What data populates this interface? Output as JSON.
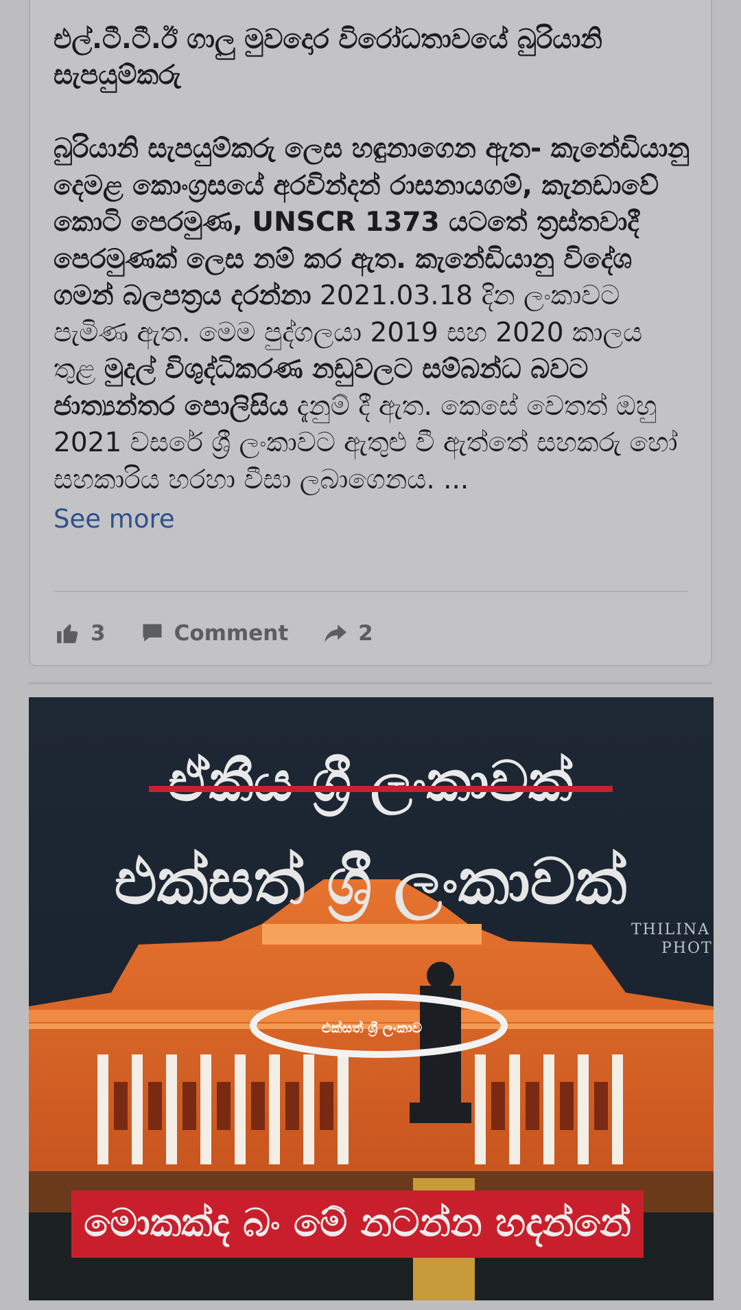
{
  "post": {
    "headline": "එල්.ටී.ටී.ඊ ගාලු මුවදොර විරෝධතාවයේ බුරියානි සැපයුම්කරු",
    "body_bold_1": "බුරියානි සැපයුම්කරු ලෙස හඳුනාගෙන ඇත- කැනේඩියානු දෙමළ කොංග්‍රසයේ අරවින්දන් රාසනායගම්, කැනඩාවේ කොටි පෙරමුණ, UNSCR 1373 යටතේ ත්‍රස්තවාදී පෙරමුණක් ලෙස නම් කර ඇත. කැනේඩියානු විදේශ ගමන් බලපත්‍රය දරන්නා",
    "body_normal_1": " 2021.03.18 දින ලංකාවට පැමිණ ඇත. මෙම පුද්ගලයා 2019 සහ 2020 කාලය තුළ ",
    "body_bold_2": "මුදල් විශුද්ධිකරණ නඩුවලට සම්බන්ධ බවට ජාත්‍යන්තර පොලිසිය",
    "body_normal_2": " දැනුම් දී ඇත.  කෙසේ වෙතත් ඔහු 2021 වසරේ ශ්‍රී ලංකාවට ඇතුළු වී ඇත්තේ සහකරු හෝ සහකාරිය හරහා වීසා ලබාගෙනය. ...",
    "see_more": "See more"
  },
  "actions": {
    "like_count": "3",
    "comment_label": "Comment",
    "share_count": "2"
  },
  "image": {
    "struck_line": "ඒකීය ශ්‍රී ලංකාවක්",
    "main_line": "එක්සත් ශ්‍රී ලංකාවක්",
    "watermark_1": "THILINA K",
    "watermark_2": "PHOTO",
    "banner_small": "එක්සත් ශ්‍රී ලංකාව",
    "bottom_banner": "මොකක්ද බං මේ නටන්න හදන්නේ"
  },
  "colors": {
    "link": "#2f4f8e",
    "strike": "#c8202e",
    "banner": "#c91f2c",
    "building": "#e0602a"
  }
}
